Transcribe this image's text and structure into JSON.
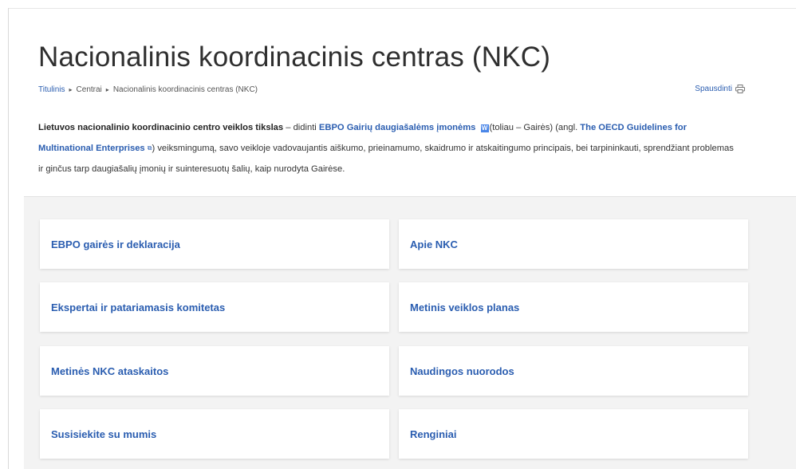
{
  "page": {
    "title": "Nacionalinis koordinacinis centras (NKC)"
  },
  "breadcrumb": {
    "items": [
      "Titulinis",
      "Centrai",
      "Nacionalinis koordinacinis centras (NKC)"
    ],
    "separator": "▸"
  },
  "print": {
    "label": "Spausdinti",
    "icon": "printer-icon"
  },
  "intro": {
    "lead_bold": "Lietuvos nacionalinio koordinacinio centro veiklos tikslas",
    "dash_text": " – didinti ",
    "link_ebpo": "EBPO Gairių daugiašalėms įmonėms",
    "w_badge": "W",
    "after_ebpo": "(toliau – Gairės) (angl. ",
    "link_oecd": "The OECD Guidelines for Multinational Enterprises",
    "external_icon": "external-link-icon",
    "rest": ") veiksmingumą, savo veikloje vadovaujantis aiškumo, prieinamumo, skaidrumo ir atskaitingumo principais, bei tarpininkauti, sprendžiant problemas ir ginčus tarp daugiašalių įmonių ir suinteresuotų šalių, kaip nurodyta Gairėse."
  },
  "cards": [
    "EBPO gairės ir deklaracija",
    "Apie NKC",
    "Ekspertai ir patariamasis komitetas",
    "Metinis veiklos planas",
    "Metinės NKC ataskaitos",
    "Naudingos nuorodos",
    "Susisiekite su mumis",
    "Renginiai"
  ],
  "colors": {
    "link": "#2a5db0",
    "grid_background": "#f3f3f3",
    "card_background": "#ffffff"
  }
}
